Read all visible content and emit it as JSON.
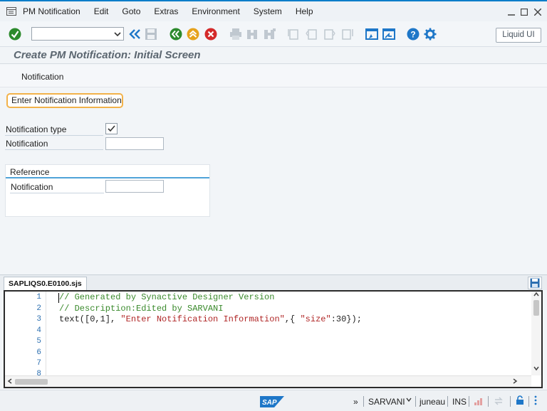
{
  "menu": {
    "items": [
      "PM Notification",
      "Edit",
      "Goto",
      "Extras",
      "Environment",
      "System",
      "Help"
    ]
  },
  "toolbar": {
    "command_field_value": "",
    "liquid_ui_label": "Liquid UI",
    "icons": [
      "enter-icon",
      "back-double-icon",
      "save-icon",
      "back-icon",
      "exit-icon",
      "cancel-icon",
      "print-icon",
      "find-icon",
      "find-next-icon",
      "first-page-icon",
      "prev-page-icon",
      "next-page-icon",
      "last-page-icon",
      "new-session-icon",
      "shortcut-icon",
      "help-icon",
      "customize-icon"
    ]
  },
  "screen": {
    "title": "Create PM Notification: Initial Screen",
    "app_toolbar_button": "Notification",
    "highlight_label": "Enter Notification Information",
    "fields": {
      "notification_type_label": "Notification type",
      "notification_type_checked": true,
      "notification_label": "Notification",
      "notification_value": ""
    },
    "reference": {
      "title": "Reference",
      "notification_label": "Notification",
      "notification_value": ""
    }
  },
  "editor": {
    "tab": "SAPLIQS0.E0100.sjs",
    "line_numbers": [
      "1",
      "2",
      "3",
      "4",
      "5",
      "6",
      "7",
      "8"
    ],
    "lines": {
      "l1": "// Generated by Synactive Designer Version",
      "l2": "// Description:Edited by SARVANI",
      "l3_a": "text([0,1], ",
      "l3_str1": "\"Enter Notification Information\"",
      "l3_b": ",{ ",
      "l3_str2": "\"size\"",
      "l3_c": ":30});"
    }
  },
  "status": {
    "chevrons": "»",
    "user": "SARVANI",
    "server": "juneau",
    "mode": "INS"
  },
  "colors": {
    "accent_blue": "#0a7dc9",
    "highlight_orange": "#f2b24a",
    "comment_green": "#3a8a2c",
    "string_red": "#b02727"
  }
}
